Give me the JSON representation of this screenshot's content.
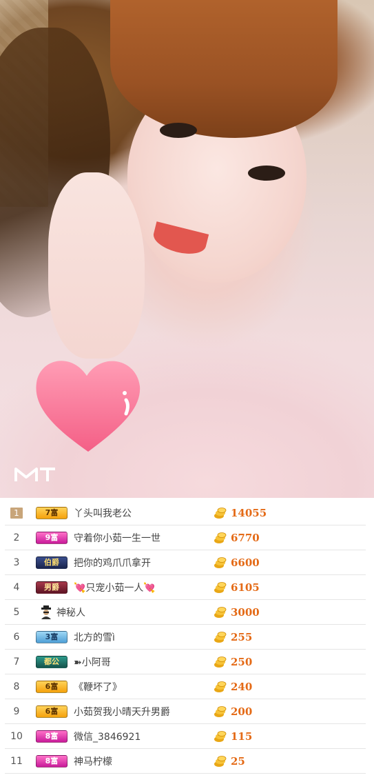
{
  "photo": {
    "watermark": "MT"
  },
  "ranking": {
    "rows": [
      {
        "rank": "1",
        "badge": "7富",
        "badge_color": "#f5a10c",
        "name": "丫头叫我老公",
        "score": "14055"
      },
      {
        "rank": "2",
        "badge": "9富",
        "badge_color": "#c81a9a",
        "name": "守着你小茹一生一世",
        "score": "6770"
      },
      {
        "rank": "3",
        "badge": "伯爵",
        "badge_color": "#1a254e",
        "name": "把你的鸡爪爪拿开",
        "score": "6600"
      },
      {
        "rank": "4",
        "badge": "男爵",
        "badge_color": "#5e1424",
        "name": "💘只宠小茹一人💘",
        "score": "6105"
      },
      {
        "rank": "5",
        "badge": "",
        "badge_color": "",
        "name": "神秘人",
        "score": "3000"
      },
      {
        "rank": "6",
        "badge": "3富",
        "badge_color": "#4f9fd6",
        "name": "北方的雪ì",
        "score": "255"
      },
      {
        "rank": "7",
        "badge": "都公",
        "badge_color": "#15544c",
        "name": "➽小阿哥",
        "score": "250"
      },
      {
        "rank": "8",
        "badge": "6富",
        "badge_color": "#f5a10c",
        "name": "《鞭坏了》",
        "score": "240"
      },
      {
        "rank": "9",
        "badge": "6富",
        "badge_color": "#f5a10c",
        "name": "小茹贺我小晴天升男爵",
        "score": "200"
      },
      {
        "rank": "10",
        "badge": "8富",
        "badge_color": "#c81a9a",
        "name": "微信_3846921",
        "score": "115"
      },
      {
        "rank": "11",
        "badge": "8富",
        "badge_color": "#c81a9a",
        "name": "神马柠檬",
        "score": "25"
      }
    ]
  }
}
